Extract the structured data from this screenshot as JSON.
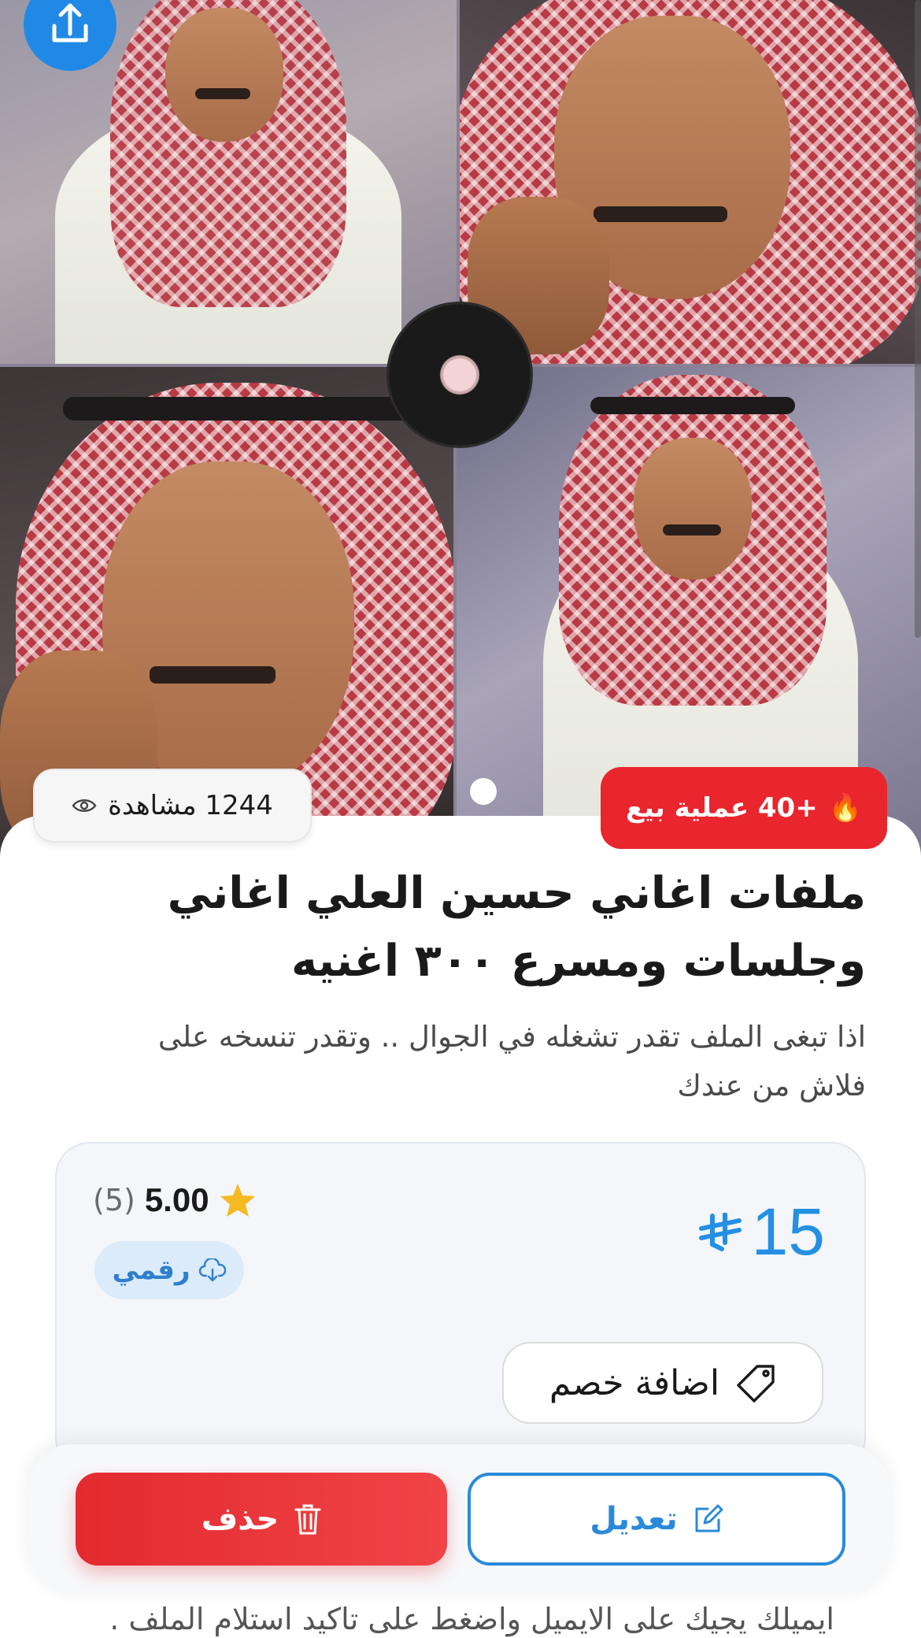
{
  "product": {
    "title": "ملفات اغاني حسين العلي اغاني وجلسات ومسرع ٣٠٠ اغنيه",
    "description": "اذا تبغى الملف تقدر تشغله في الجوال .. وتقدر تنسخه على فلاش من عندك",
    "views_text": "1244 مشاهدة",
    "sales_text": "+40 عملية بيع",
    "price": "15",
    "currency_icon": "riyal-icon",
    "rating_score": "5.00",
    "rating_count": "(5)",
    "type_badge": "رقمي",
    "image_pages": 1
  },
  "actions": {
    "add_discount": "اضافة خصم",
    "edit": "تعديل",
    "delete": "حذف"
  },
  "footer_text": "ايميلك يجيك على الايميل واضغط على تاكيد استلام الملف .",
  "colors": {
    "primary_blue": "#2089e5",
    "danger_red": "#e9252d",
    "star_yellow": "#f5b921"
  }
}
